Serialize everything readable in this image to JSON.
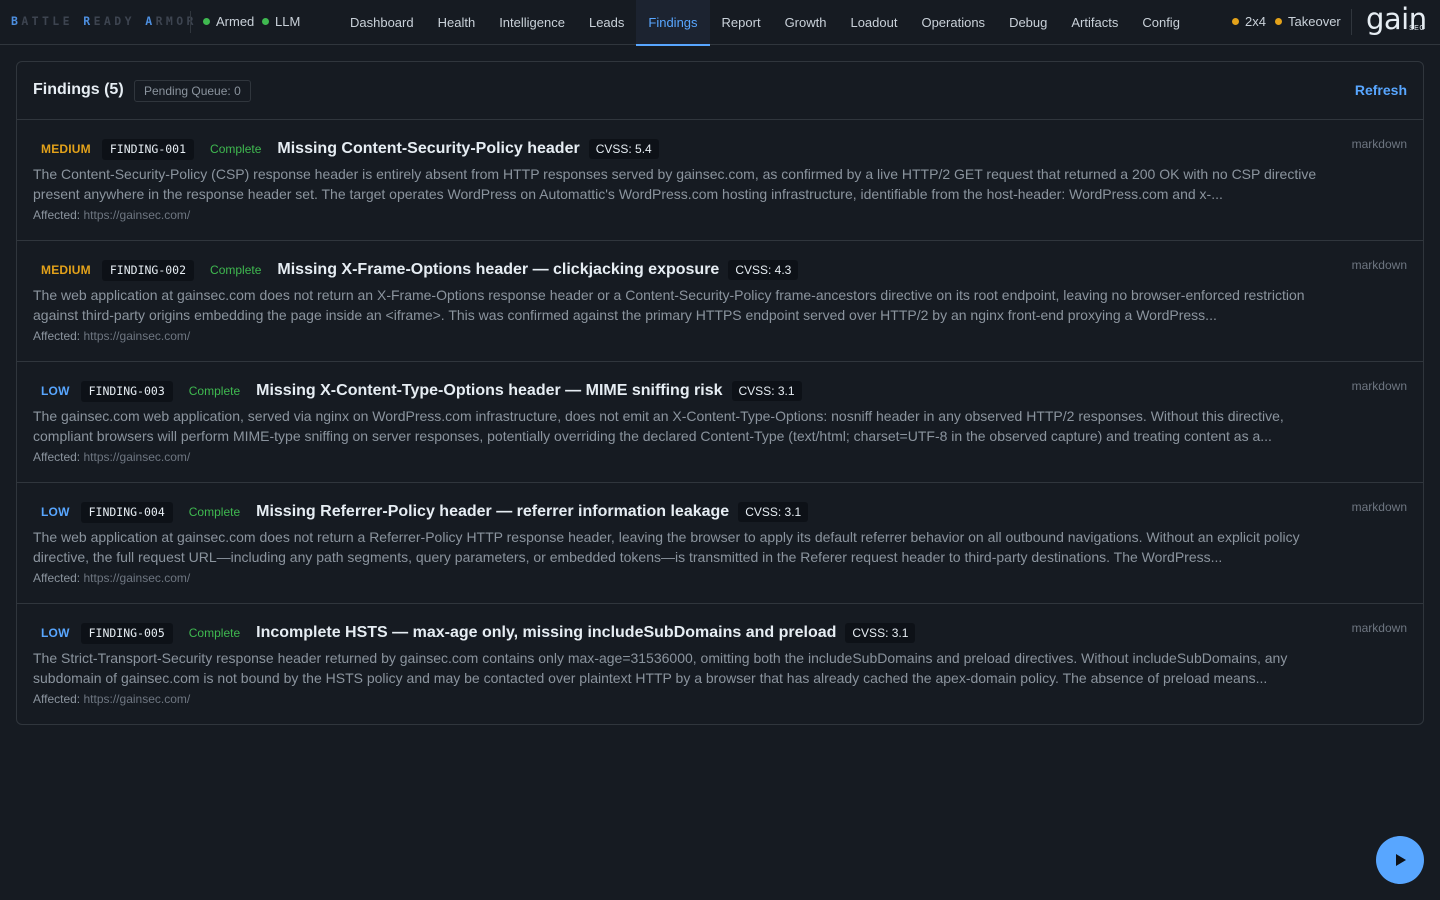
{
  "brand": {
    "parts": [
      {
        "cap": "B",
        "rest": "ATTLE "
      },
      {
        "cap": "R",
        "rest": "EADY "
      },
      {
        "cap": "A",
        "rest": "RMOR"
      }
    ]
  },
  "status": {
    "armed": "Armed",
    "llm": "LLM",
    "grid": "2x4",
    "takeover": "Takeover"
  },
  "nav": {
    "items": [
      "Dashboard",
      "Health",
      "Intelligence",
      "Leads",
      "Findings",
      "Report",
      "Growth",
      "Loadout",
      "Operations",
      "Debug",
      "Artifacts",
      "Config"
    ],
    "active": "Findings"
  },
  "logo": {
    "text": "gain",
    "sub": "SEC"
  },
  "panel": {
    "title": "Findings (5)",
    "pending": "Pending Queue: 0",
    "refresh": "Refresh"
  },
  "findings": [
    {
      "severity": "MEDIUM",
      "id": "FINDING-001",
      "state": "Complete",
      "title": "Missing Content-Security-Policy header",
      "cvss": "CVSS: 5.4",
      "description": "The Content-Security-Policy (CSP) response header is entirely absent from HTTP responses served by gainsec.com, as confirmed by a live HTTP/2 GET request that returned a 200 OK with no CSP directive present anywhere in the response header set. The target operates WordPress on Automattic's WordPress.com hosting infrastructure, identifiable from the host-header: WordPress.com and x-...",
      "affected_label": "Affected:",
      "affected_url": "https://gainsec.com/",
      "format": "markdown"
    },
    {
      "severity": "MEDIUM",
      "id": "FINDING-002",
      "state": "Complete",
      "title": "Missing X-Frame-Options header — clickjacking exposure",
      "cvss": "CVSS: 4.3",
      "description": "The web application at gainsec.com does not return an X-Frame-Options response header or a Content-Security-Policy frame-ancestors directive on its root endpoint, leaving no browser-enforced restriction against third-party origins embedding the page inside an <iframe>. This was confirmed against the primary HTTPS endpoint served over HTTP/2 by an nginx front-end proxying a WordPress...",
      "affected_label": "Affected:",
      "affected_url": "https://gainsec.com/",
      "format": "markdown"
    },
    {
      "severity": "LOW",
      "id": "FINDING-003",
      "state": "Complete",
      "title": "Missing X-Content-Type-Options header — MIME sniffing risk",
      "cvss": "CVSS: 3.1",
      "description": "The gainsec.com web application, served via nginx on WordPress.com infrastructure, does not emit an X-Content-Type-Options: nosniff header in any observed HTTP/2 responses. Without this directive, compliant browsers will perform MIME-type sniffing on server responses, potentially overriding the declared Content-Type (text/html; charset=UTF-8 in the observed capture) and treating content as a...",
      "affected_label": "Affected:",
      "affected_url": "https://gainsec.com/",
      "format": "markdown"
    },
    {
      "severity": "LOW",
      "id": "FINDING-004",
      "state": "Complete",
      "title": "Missing Referrer-Policy header — referrer information leakage",
      "cvss": "CVSS: 3.1",
      "description": "The web application at gainsec.com does not return a Referrer-Policy HTTP response header, leaving the browser to apply its default referrer behavior on all outbound navigations. Without an explicit policy directive, the full request URL—including any path segments, query parameters, or embedded tokens—is transmitted in the Referer request header to third-party destinations. The WordPress...",
      "affected_label": "Affected:",
      "affected_url": "https://gainsec.com/",
      "format": "markdown"
    },
    {
      "severity": "LOW",
      "id": "FINDING-005",
      "state": "Complete",
      "title": "Incomplete HSTS — max-age only, missing includeSubDomains and preload",
      "cvss": "CVSS: 3.1",
      "description": "The Strict-Transport-Security response header returned by gainsec.com contains only max-age=31536000, omitting both the includeSubDomains and preload directives. Without includeSubDomains, any subdomain of gainsec.com is not bound by the HSTS policy and may be contacted over plaintext HTTP by a browser that has already cached the apex-domain policy. The absence of preload means...",
      "affected_label": "Affected:",
      "affected_url": "https://gainsec.com/",
      "format": "markdown"
    }
  ],
  "colors": {
    "accent": "#58a6ff",
    "medium": "#e3a21a",
    "low": "#58a6ff",
    "complete": "#3fb950",
    "background": "#161b22"
  },
  "icons": {
    "fab": "play-icon"
  }
}
